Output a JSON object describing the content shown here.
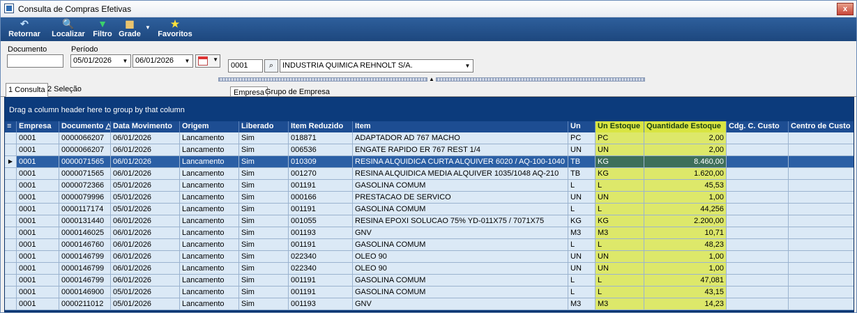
{
  "window": {
    "title": "Consulta de Compras Efetivas",
    "close_label": "x"
  },
  "toolbar": {
    "buttons": [
      {
        "label": "Retornar",
        "icon": "return-arrow-icon"
      },
      {
        "label": "Localizar",
        "icon": "search-icon"
      },
      {
        "label": "Filtro",
        "icon": "funnel-icon"
      },
      {
        "label": "Grade",
        "icon": "grid-icon"
      },
      {
        "label": "Favoritos",
        "icon": "star-icon"
      }
    ]
  },
  "filters": {
    "documento_label": "Documento",
    "documento_value": "",
    "periodo_label": "Período",
    "date_from": "05/01/2026",
    "date_to": "06/01/2026",
    "tab_empresa": "Empresa",
    "tab_grupo": "Grupo de Empresa",
    "empresa_code": "0001",
    "empresa_name": "INDUSTRIA QUIMICA REHNOLT S/A."
  },
  "page_tabs": [
    {
      "label": "1 Consulta",
      "active": true
    },
    {
      "label": "2 Seleção",
      "active": false
    }
  ],
  "grid": {
    "group_hint": "Drag a column header here to group by that column",
    "columns": [
      "Empresa",
      "Documento",
      "Data Movimento",
      "Origem",
      "Liberado",
      "Item Reduzido",
      "Item",
      "Un",
      "Un Estoque",
      "Quantidade Estoque",
      "Cdg. C. Custo",
      "Centro de Custo"
    ],
    "selected_row": 2,
    "rows": [
      [
        "0001",
        "0000066207",
        "06/01/2026",
        "Lancamento",
        "Sim",
        "018871",
        "ADAPTADOR AD 767 MACHO",
        "PC",
        "PC",
        "2,00",
        "",
        ""
      ],
      [
        "0001",
        "0000066207",
        "06/01/2026",
        "Lancamento",
        "Sim",
        "006536",
        "ENGATE RAPIDO ER 767 REST 1/4",
        "UN",
        "UN",
        "2,00",
        "",
        ""
      ],
      [
        "0001",
        "0000071565",
        "06/01/2026",
        "Lancamento",
        "Sim",
        "010309",
        "RESINA ALQUIDICA CURTA ALQUIVER 6020 / AQ-100-1040",
        "TB",
        "KG",
        "8.460,00",
        "",
        ""
      ],
      [
        "0001",
        "0000071565",
        "06/01/2026",
        "Lancamento",
        "Sim",
        "001270",
        "RESINA ALQUIDICA MEDIA ALQUIVER 1035/1048 AQ-210",
        "TB",
        "KG",
        "1.620,00",
        "",
        ""
      ],
      [
        "0001",
        "0000072366",
        "05/01/2026",
        "Lancamento",
        "Sim",
        "001191",
        "GASOLINA COMUM",
        "L",
        "L",
        "45,53",
        "",
        ""
      ],
      [
        "0001",
        "0000079996",
        "05/01/2026",
        "Lancamento",
        "Sim",
        "000166",
        "PRESTACAO DE SERVICO",
        "UN",
        "UN",
        "1,00",
        "",
        ""
      ],
      [
        "0001",
        "0000117174",
        "05/01/2026",
        "Lancamento",
        "Sim",
        "001191",
        "GASOLINA COMUM",
        "L",
        "L",
        "44,256",
        "",
        ""
      ],
      [
        "0001",
        "0000131440",
        "06/01/2026",
        "Lancamento",
        "Sim",
        "001055",
        "RESINA EPOXI SOLUCAO 75% YD-011X75 / 7071X75",
        "KG",
        "KG",
        "2.200,00",
        "",
        ""
      ],
      [
        "0001",
        "0000146025",
        "06/01/2026",
        "Lancamento",
        "Sim",
        "001193",
        "GNV",
        "M3",
        "M3",
        "10,71",
        "",
        ""
      ],
      [
        "0001",
        "0000146760",
        "06/01/2026",
        "Lancamento",
        "Sim",
        "001191",
        "GASOLINA COMUM",
        "L",
        "L",
        "48,23",
        "",
        ""
      ],
      [
        "0001",
        "0000146799",
        "06/01/2026",
        "Lancamento",
        "Sim",
        "022340",
        "OLEO 90",
        "UN",
        "UN",
        "1,00",
        "",
        ""
      ],
      [
        "0001",
        "0000146799",
        "06/01/2026",
        "Lancamento",
        "Sim",
        "022340",
        "OLEO 90",
        "UN",
        "UN",
        "1,00",
        "",
        ""
      ],
      [
        "0001",
        "0000146799",
        "06/01/2026",
        "Lancamento",
        "Sim",
        "001191",
        "GASOLINA COMUM",
        "L",
        "L",
        "47,081",
        "",
        ""
      ],
      [
        "0001",
        "0000146900",
        "05/01/2026",
        "Lancamento",
        "Sim",
        "001191",
        "GASOLINA COMUM",
        "L",
        "L",
        "43,15",
        "",
        ""
      ],
      [
        "0001",
        "0000211012",
        "05/01/2026",
        "Lancamento",
        "Sim",
        "001193",
        "GNV",
        "M3",
        "M3",
        "14,23",
        "",
        ""
      ]
    ]
  }
}
